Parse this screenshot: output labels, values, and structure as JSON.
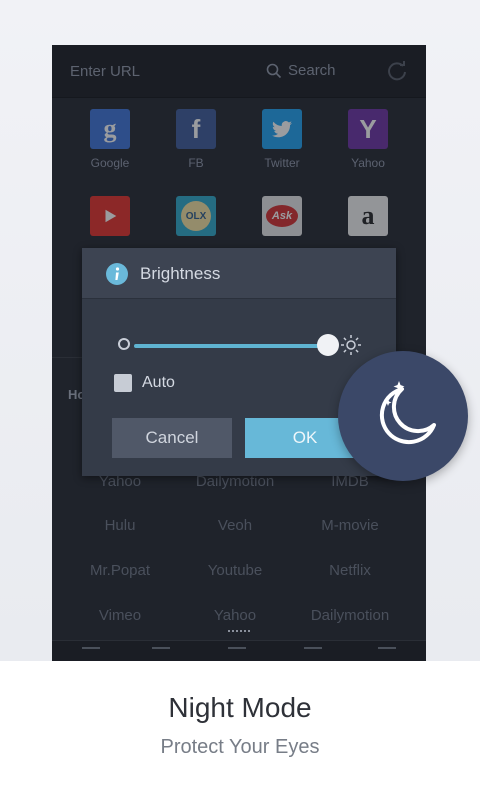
{
  "browser": {
    "url_placeholder": "Enter URL",
    "search_label": "Search"
  },
  "quick_links": [
    {
      "label": "Google",
      "glyph": "g",
      "color": "#3b72d9"
    },
    {
      "label": "FB",
      "glyph": "f",
      "color": "#3b5998"
    },
    {
      "label": "Twitter",
      "glyph": "",
      "color": "#1da1f2"
    },
    {
      "label": "Yahoo",
      "glyph": "Y",
      "color": "#6b2fa3"
    },
    {
      "label": "Youtube",
      "glyph": "",
      "color": "#e52d27"
    },
    {
      "label": "OLX",
      "glyph": "OLX",
      "color": "#2aa8c9"
    },
    {
      "label": "Ask",
      "glyph": "Ask",
      "color": "#e8e8e8"
    },
    {
      "label": "Amazon",
      "glyph": "a",
      "color": "#f2f2f2"
    }
  ],
  "home_section_title": "Ho",
  "sites": [
    [
      "Yahoo",
      "Dailymotion",
      "IMDB"
    ],
    [
      "Hulu",
      "Veoh",
      "M-movie"
    ],
    [
      "Mr.Popat",
      "Youtube",
      "Netflix"
    ],
    [
      "Vimeo",
      "Yahoo",
      "Dailymotion"
    ]
  ],
  "dialog": {
    "title": "Brightness",
    "brightness_level": 1.0,
    "auto_label": "Auto",
    "auto_checked": false,
    "cancel_label": "Cancel",
    "ok_label": "OK"
  },
  "caption": {
    "title": "Night Mode",
    "subtitle": "Protect Your Eyes"
  },
  "colors": {
    "accent": "#67b8d8",
    "badge": "#3b4868"
  }
}
